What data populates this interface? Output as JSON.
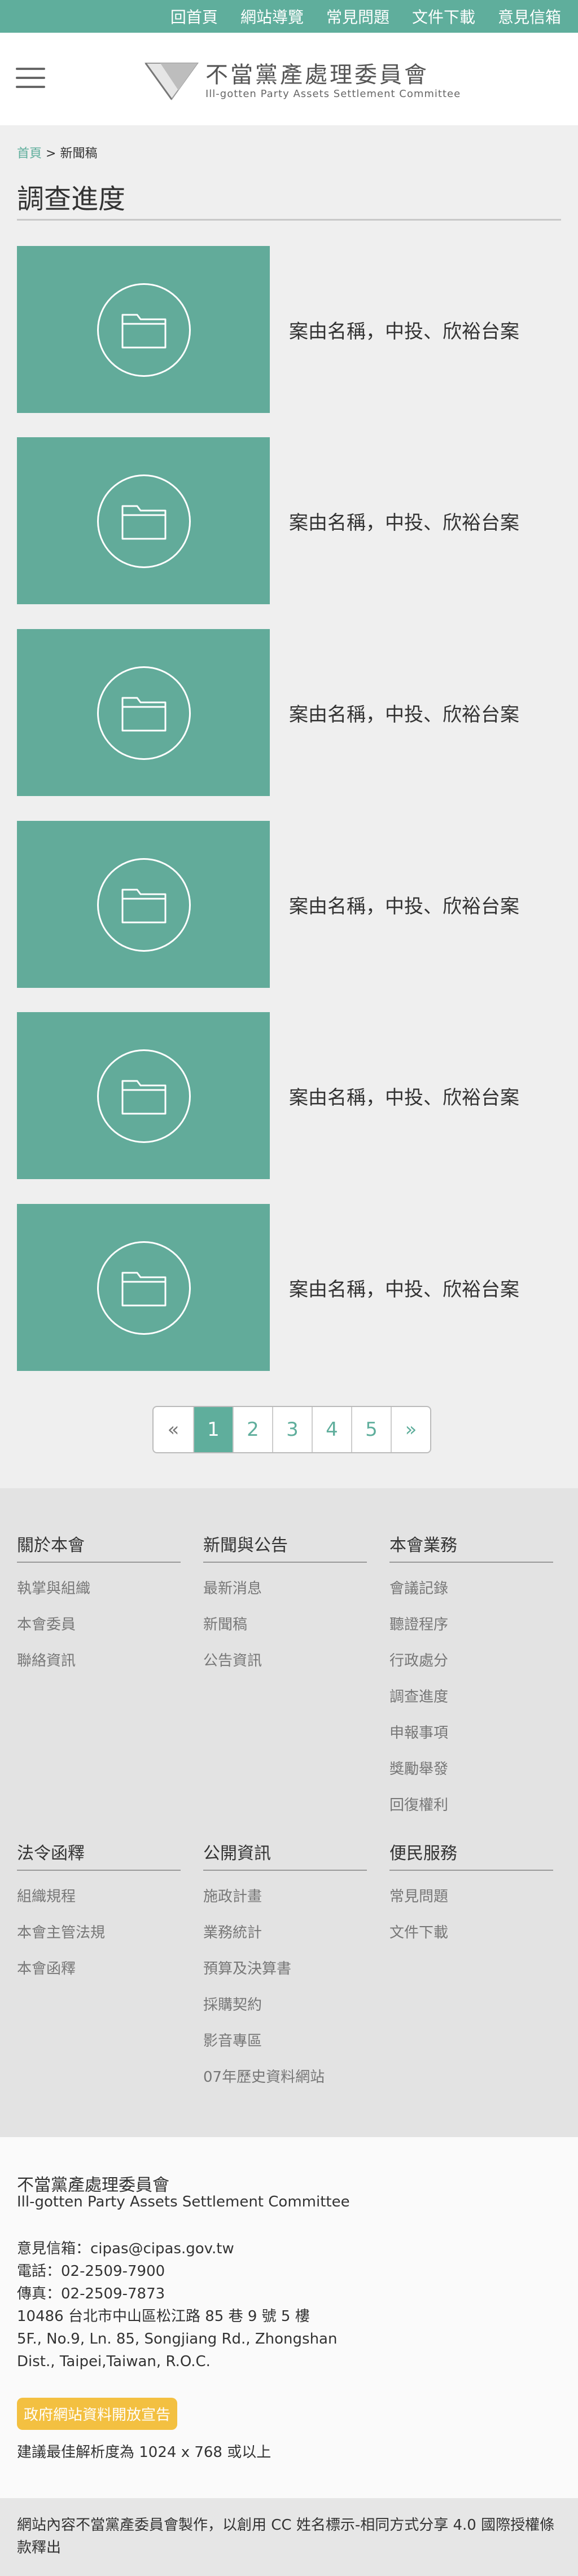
{
  "topnav": [
    "回首頁",
    "網站導覽",
    "常見問題",
    "文件下載",
    "意見信箱"
  ],
  "header": {
    "logo_zh": "不當黨產處理委員會",
    "logo_en": "Ill-gotten Party Assets Settlement Committee"
  },
  "breadcrumb": {
    "home": "首頁",
    "sep": " > ",
    "current": "新聞稿"
  },
  "page_title": "調查進度",
  "cards": [
    {
      "title": "案由名稱，中投、欣裕台案"
    },
    {
      "title": "案由名稱，中投、欣裕台案"
    },
    {
      "title": "案由名稱，中投、欣裕台案"
    },
    {
      "title": "案由名稱，中投、欣裕台案"
    },
    {
      "title": "案由名稱，中投、欣裕台案"
    },
    {
      "title": "案由名稱，中投、欣裕台案"
    }
  ],
  "pagination": {
    "prev": "«",
    "pages": [
      "1",
      "2",
      "3",
      "4",
      "5"
    ],
    "next": "»",
    "active": "1"
  },
  "footer_sections": [
    {
      "heading": "關於本會",
      "links": [
        "執掌與組織",
        "本會委員",
        "聯絡資訊"
      ]
    },
    {
      "heading": "新聞與公告",
      "links": [
        "最新消息",
        "新聞稿",
        "公告資訊"
      ]
    },
    {
      "heading": "本會業務",
      "links": [
        "會議記錄",
        "聽證程序",
        "行政處分",
        "調查進度",
        "申報事項",
        "獎勵舉發",
        "回復權利"
      ]
    },
    {
      "heading": "法令函釋",
      "links": [
        "組織規程",
        "本會主管法規",
        "本會函釋"
      ]
    },
    {
      "heading": "公開資訊",
      "links": [
        "施政計畫",
        "業務統計",
        "預算及決算書",
        "採購契約",
        "影音專區",
        "07年歷史資料網站"
      ]
    },
    {
      "heading": "便民服務",
      "links": [
        "常見問題",
        "文件下載"
      ]
    }
  ],
  "contact": {
    "org_zh": "不當黨產處理委員會",
    "org_en": "Ill-gotten Party Assets Settlement Committee",
    "email": "意見信箱：cipas@cipas.gov.tw",
    "phone": "電話：02-2509-7900",
    "fax": "傳真：02-2509-7873",
    "address_zh": "10486 台北市中山區松江路 85 巷 9 號 5 樓",
    "address_en_1": "5F., No.9, Ln. 85, Songjiang Rd., Zhongshan",
    "address_en_2": "Dist., Taipei,Taiwan, R.O.C.",
    "open_data_badge": "政府網站資料開放宣告",
    "resolution": "建議最佳解析度為 1024 x 768 或以上"
  },
  "license": "網站內容不當黨產委員會製作，以創用 CC 姓名標示-相同方式分享 4.0 國際授權條款釋出",
  "colors": {
    "brand": "#5fae9c",
    "badge": "#f3c041"
  }
}
